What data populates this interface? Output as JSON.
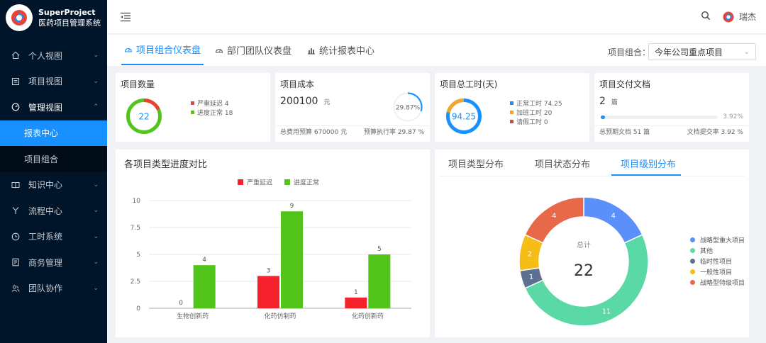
{
  "app": {
    "title": "SuperProject",
    "subtitle": "医药项目管理系统"
  },
  "sidebar": {
    "items": [
      {
        "label": "个人视图"
      },
      {
        "label": "项目视图"
      },
      {
        "label": "管理视图",
        "children": [
          {
            "label": "报表中心"
          },
          {
            "label": "项目组合"
          }
        ]
      },
      {
        "label": "知识中心"
      },
      {
        "label": "流程中心"
      },
      {
        "label": "工时系统"
      },
      {
        "label": "商务管理"
      },
      {
        "label": "团队协作"
      }
    ]
  },
  "header": {
    "user_name": "瑞杰"
  },
  "tabs": [
    {
      "label": "项目组合仪表盘"
    },
    {
      "label": "部门团队仪表盘"
    },
    {
      "label": "统计报表中心"
    }
  ],
  "filter": {
    "label": "项目组合：",
    "value": "今年公司重点项目"
  },
  "cards": {
    "project_count": {
      "title": "项目数量",
      "total": "22",
      "legend": [
        "严重延迟 4",
        "进度正常 18"
      ],
      "colors": [
        "#e8433a",
        "#52c41a"
      ]
    },
    "project_cost": {
      "title": "项目成本",
      "value": "200100",
      "unit": "元",
      "percent": "29.87%",
      "percent_value": 0.2987,
      "foot_left": "总费用预算 670000 元",
      "foot_right": "预算执行率 29.87 %"
    },
    "work_hours": {
      "title": "项目总工时(天)",
      "total": "94.25",
      "legend": [
        "正常工时 74.25",
        "加班工时 20",
        "请假工时 0"
      ],
      "colors": [
        "#1890ff",
        "#f5a623",
        "#e8433a"
      ]
    },
    "deliverables": {
      "title": "项目交付文档",
      "value": "2",
      "unit": "篇",
      "percent": "3.92%",
      "percent_value": 0.0392,
      "foot_left": "总预期文档 51 篇",
      "foot_right": "文档提交率 3.92 %"
    }
  },
  "bar_panel": {
    "title": "各项目类型进度对比"
  },
  "chart_data": [
    {
      "type": "bar",
      "title": "各项目类型进度对比",
      "categories": [
        "生物创新药",
        "化药仿制药",
        "化药创新药"
      ],
      "series": [
        {
          "name": "严重延迟",
          "values": [
            0,
            3,
            1
          ],
          "color": "#f5222d"
        },
        {
          "name": "进度正常",
          "values": [
            4,
            9,
            5
          ],
          "color": "#52c41a"
        }
      ],
      "yticks": [
        "0",
        "2.5",
        "5",
        "7.5",
        "10"
      ],
      "ylim": [
        0,
        10
      ],
      "legend": "top-center"
    },
    {
      "type": "pie",
      "title": "项目级别分布",
      "center_label": "总计",
      "center_value": "22",
      "slices": [
        {
          "name": "战略型重大项目",
          "value": 4,
          "color": "#5b8ff9"
        },
        {
          "name": "其他",
          "value": 11,
          "color": "#5ad8a6"
        },
        {
          "name": "临时性项目",
          "value": 1,
          "color": "#5d7092"
        },
        {
          "name": "一般性项目",
          "value": 2,
          "color": "#f6bd16"
        },
        {
          "name": "战略型特级项目",
          "value": 4,
          "color": "#e8684a"
        }
      ],
      "legend": "right"
    }
  ],
  "dist_panel": {
    "tabs": [
      "项目类型分布",
      "项目状态分布",
      "项目级别分布"
    ]
  }
}
